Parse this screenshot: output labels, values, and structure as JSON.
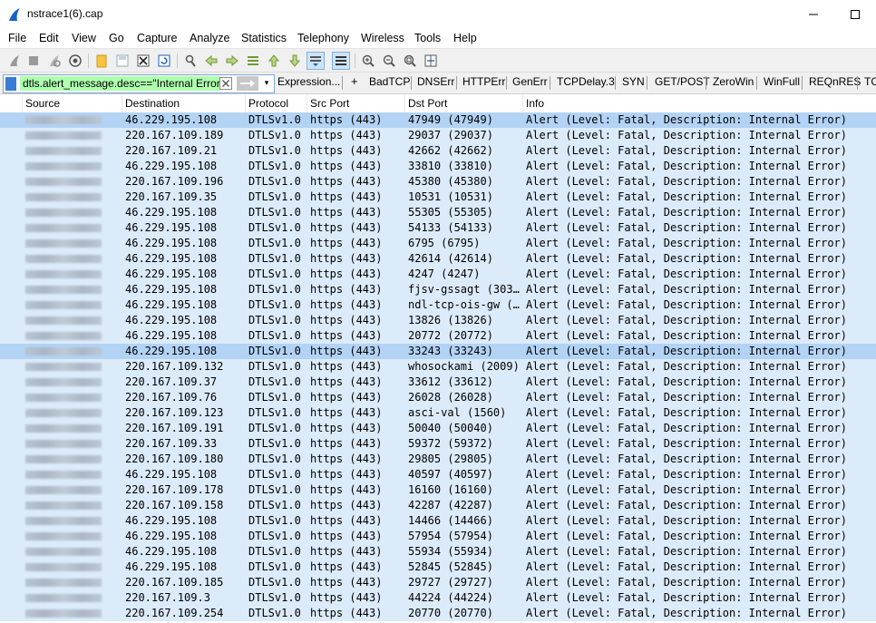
{
  "window": {
    "title": "nstrace1(6).cap"
  },
  "menu": [
    "File",
    "Edit",
    "View",
    "Go",
    "Capture",
    "Analyze",
    "Statistics",
    "Telephony",
    "Wireless",
    "Tools",
    "Help"
  ],
  "filter": {
    "value": "dtls.alert_message.desc==\"Internal Error\"",
    "expression_label": "Expression...",
    "add_label": "+",
    "buttons": [
      "BadTCP",
      "DNSErr",
      "HTTPErr",
      "GenErr",
      "TCPDelay.3",
      "SYN",
      "GET/POST",
      "ZeroWin",
      "WinFull",
      "REQnRES",
      "TC"
    ]
  },
  "columns": [
    "Source",
    "Destination",
    "Protocol",
    "Src Port",
    "Dst Port",
    "Info"
  ],
  "rows": [
    [
      "46.229.195.108",
      "DTLSv1.0",
      "https (443)",
      "47949 (47949)",
      "Alert (Level: Fatal, Description: Internal Error)"
    ],
    [
      "220.167.109.189",
      "DTLSv1.0",
      "https (443)",
      "29037 (29037)",
      "Alert (Level: Fatal, Description: Internal Error)"
    ],
    [
      "220.167.109.21",
      "DTLSv1.0",
      "https (443)",
      "42662 (42662)",
      "Alert (Level: Fatal, Description: Internal Error)"
    ],
    [
      "46.229.195.108",
      "DTLSv1.0",
      "https (443)",
      "33810 (33810)",
      "Alert (Level: Fatal, Description: Internal Error)"
    ],
    [
      "220.167.109.196",
      "DTLSv1.0",
      "https (443)",
      "45380 (45380)",
      "Alert (Level: Fatal, Description: Internal Error)"
    ],
    [
      "220.167.109.35",
      "DTLSv1.0",
      "https (443)",
      "10531 (10531)",
      "Alert (Level: Fatal, Description: Internal Error)"
    ],
    [
      "46.229.195.108",
      "DTLSv1.0",
      "https (443)",
      "55305 (55305)",
      "Alert (Level: Fatal, Description: Internal Error)"
    ],
    [
      "46.229.195.108",
      "DTLSv1.0",
      "https (443)",
      "54133 (54133)",
      "Alert (Level: Fatal, Description: Internal Error)"
    ],
    [
      "46.229.195.108",
      "DTLSv1.0",
      "https (443)",
      "6795 (6795)",
      "Alert (Level: Fatal, Description: Internal Error)"
    ],
    [
      "46.229.195.108",
      "DTLSv1.0",
      "https (443)",
      "42614 (42614)",
      "Alert (Level: Fatal, Description: Internal Error)"
    ],
    [
      "46.229.195.108",
      "DTLSv1.0",
      "https (443)",
      "4247 (4247)",
      "Alert (Level: Fatal, Description: Internal Error)"
    ],
    [
      "46.229.195.108",
      "DTLSv1.0",
      "https (443)",
      "fjsv-gssagt (303…",
      "Alert (Level: Fatal, Description: Internal Error)"
    ],
    [
      "46.229.195.108",
      "DTLSv1.0",
      "https (443)",
      "ndl-tcp-ois-gw (…",
      "Alert (Level: Fatal, Description: Internal Error)"
    ],
    [
      "46.229.195.108",
      "DTLSv1.0",
      "https (443)",
      "13826 (13826)",
      "Alert (Level: Fatal, Description: Internal Error)"
    ],
    [
      "46.229.195.108",
      "DTLSv1.0",
      "https (443)",
      "20772 (20772)",
      "Alert (Level: Fatal, Description: Internal Error)"
    ],
    [
      "46.229.195.108",
      "DTLSv1.0",
      "https (443)",
      "33243 (33243)",
      "Alert (Level: Fatal, Description: Internal Error)"
    ],
    [
      "220.167.109.132",
      "DTLSv1.0",
      "https (443)",
      "whosockami (2009)",
      "Alert (Level: Fatal, Description: Internal Error)"
    ],
    [
      "220.167.109.37",
      "DTLSv1.0",
      "https (443)",
      "33612 (33612)",
      "Alert (Level: Fatal, Description: Internal Error)"
    ],
    [
      "220.167.109.76",
      "DTLSv1.0",
      "https (443)",
      "26028 (26028)",
      "Alert (Level: Fatal, Description: Internal Error)"
    ],
    [
      "220.167.109.123",
      "DTLSv1.0",
      "https (443)",
      "asci-val (1560)",
      "Alert (Level: Fatal, Description: Internal Error)"
    ],
    [
      "220.167.109.191",
      "DTLSv1.0",
      "https (443)",
      "50040 (50040)",
      "Alert (Level: Fatal, Description: Internal Error)"
    ],
    [
      "220.167.109.33",
      "DTLSv1.0",
      "https (443)",
      "59372 (59372)",
      "Alert (Level: Fatal, Description: Internal Error)"
    ],
    [
      "220.167.109.180",
      "DTLSv1.0",
      "https (443)",
      "29805 (29805)",
      "Alert (Level: Fatal, Description: Internal Error)"
    ],
    [
      "46.229.195.108",
      "DTLSv1.0",
      "https (443)",
      "40597 (40597)",
      "Alert (Level: Fatal, Description: Internal Error)"
    ],
    [
      "220.167.109.178",
      "DTLSv1.0",
      "https (443)",
      "16160 (16160)",
      "Alert (Level: Fatal, Description: Internal Error)"
    ],
    [
      "220.167.109.158",
      "DTLSv1.0",
      "https (443)",
      "42287 (42287)",
      "Alert (Level: Fatal, Description: Internal Error)"
    ],
    [
      "46.229.195.108",
      "DTLSv1.0",
      "https (443)",
      "14466 (14466)",
      "Alert (Level: Fatal, Description: Internal Error)"
    ],
    [
      "46.229.195.108",
      "DTLSv1.0",
      "https (443)",
      "57954 (57954)",
      "Alert (Level: Fatal, Description: Internal Error)"
    ],
    [
      "46.229.195.108",
      "DTLSv1.0",
      "https (443)",
      "55934 (55934)",
      "Alert (Level: Fatal, Description: Internal Error)"
    ],
    [
      "46.229.195.108",
      "DTLSv1.0",
      "https (443)",
      "52845 (52845)",
      "Alert (Level: Fatal, Description: Internal Error)"
    ],
    [
      "220.167.109.185",
      "DTLSv1.0",
      "https (443)",
      "29727 (29727)",
      "Alert (Level: Fatal, Description: Internal Error)"
    ],
    [
      "220.167.109.3",
      "DTLSv1.0",
      "https (443)",
      "44224 (44224)",
      "Alert (Level: Fatal, Description: Internal Error)"
    ],
    [
      "220.167.109.254",
      "DTLSv1.0",
      "https (443)",
      "20770 (20770)",
      "Alert (Level: Fatal, Description: Internal Error)"
    ]
  ],
  "highlighted_rows": [
    0,
    15
  ],
  "icons": {
    "app": "wireshark-fin-icon",
    "toolbar": [
      "start-capture-icon",
      "stop-capture-icon",
      "restart-capture-icon",
      "capture-options-icon",
      "open-file-icon",
      "save-file-icon",
      "close-file-icon",
      "reload-file-icon",
      "find-packet-icon",
      "go-back-icon",
      "go-forward-icon",
      "go-to-packet-icon",
      "go-first-icon",
      "go-last-icon",
      "autoscroll-icon",
      "colorize-icon",
      "zoom-in-icon",
      "zoom-out-icon",
      "zoom-normal-icon",
      "resize-columns-icon"
    ]
  },
  "colors": {
    "row_bg": "#dcebfa",
    "row_selected": "#b3d3f5",
    "filter_valid": "#afffaf"
  }
}
